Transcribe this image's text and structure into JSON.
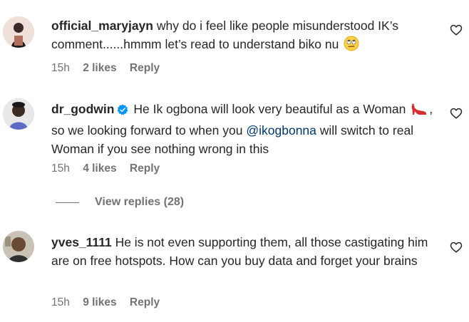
{
  "comments": [
    {
      "username": "official_maryjayn",
      "text": "why do i feel like people misunderstood IK’s comment......hmmm let’s read to understand biko nu",
      "emoji": "face-with-rolling-eyes",
      "time": "15h",
      "likes": "2 likes",
      "reply": "Reply"
    },
    {
      "username": "dr_godwin",
      "verified": true,
      "text_a": "He Ik ogbona will look very beautiful as a Woman",
      "emoji": "high-heeled-shoe",
      "text_b": ", so we looking forward to when you",
      "mention": "@ikogbonna",
      "text_c": "will switch to real Woman if you see nothing wrong in this",
      "time": "15h",
      "likes": "4 likes",
      "reply": "Reply"
    },
    {
      "username": "yves_1111",
      "text": "He is not even supporting them, all those castigating him are on free hotspots. How can you buy data and forget your brains",
      "time": "15h",
      "likes": "9 likes",
      "reply": "Reply"
    }
  ],
  "view_replies": "View replies (28)",
  "icons": {
    "like": "heart-outline-icon",
    "verified": "verified-badge-icon"
  },
  "colors": {
    "text": "#262626",
    "meta": "#737373",
    "mention": "#00376b",
    "verified": "#0095f6"
  }
}
